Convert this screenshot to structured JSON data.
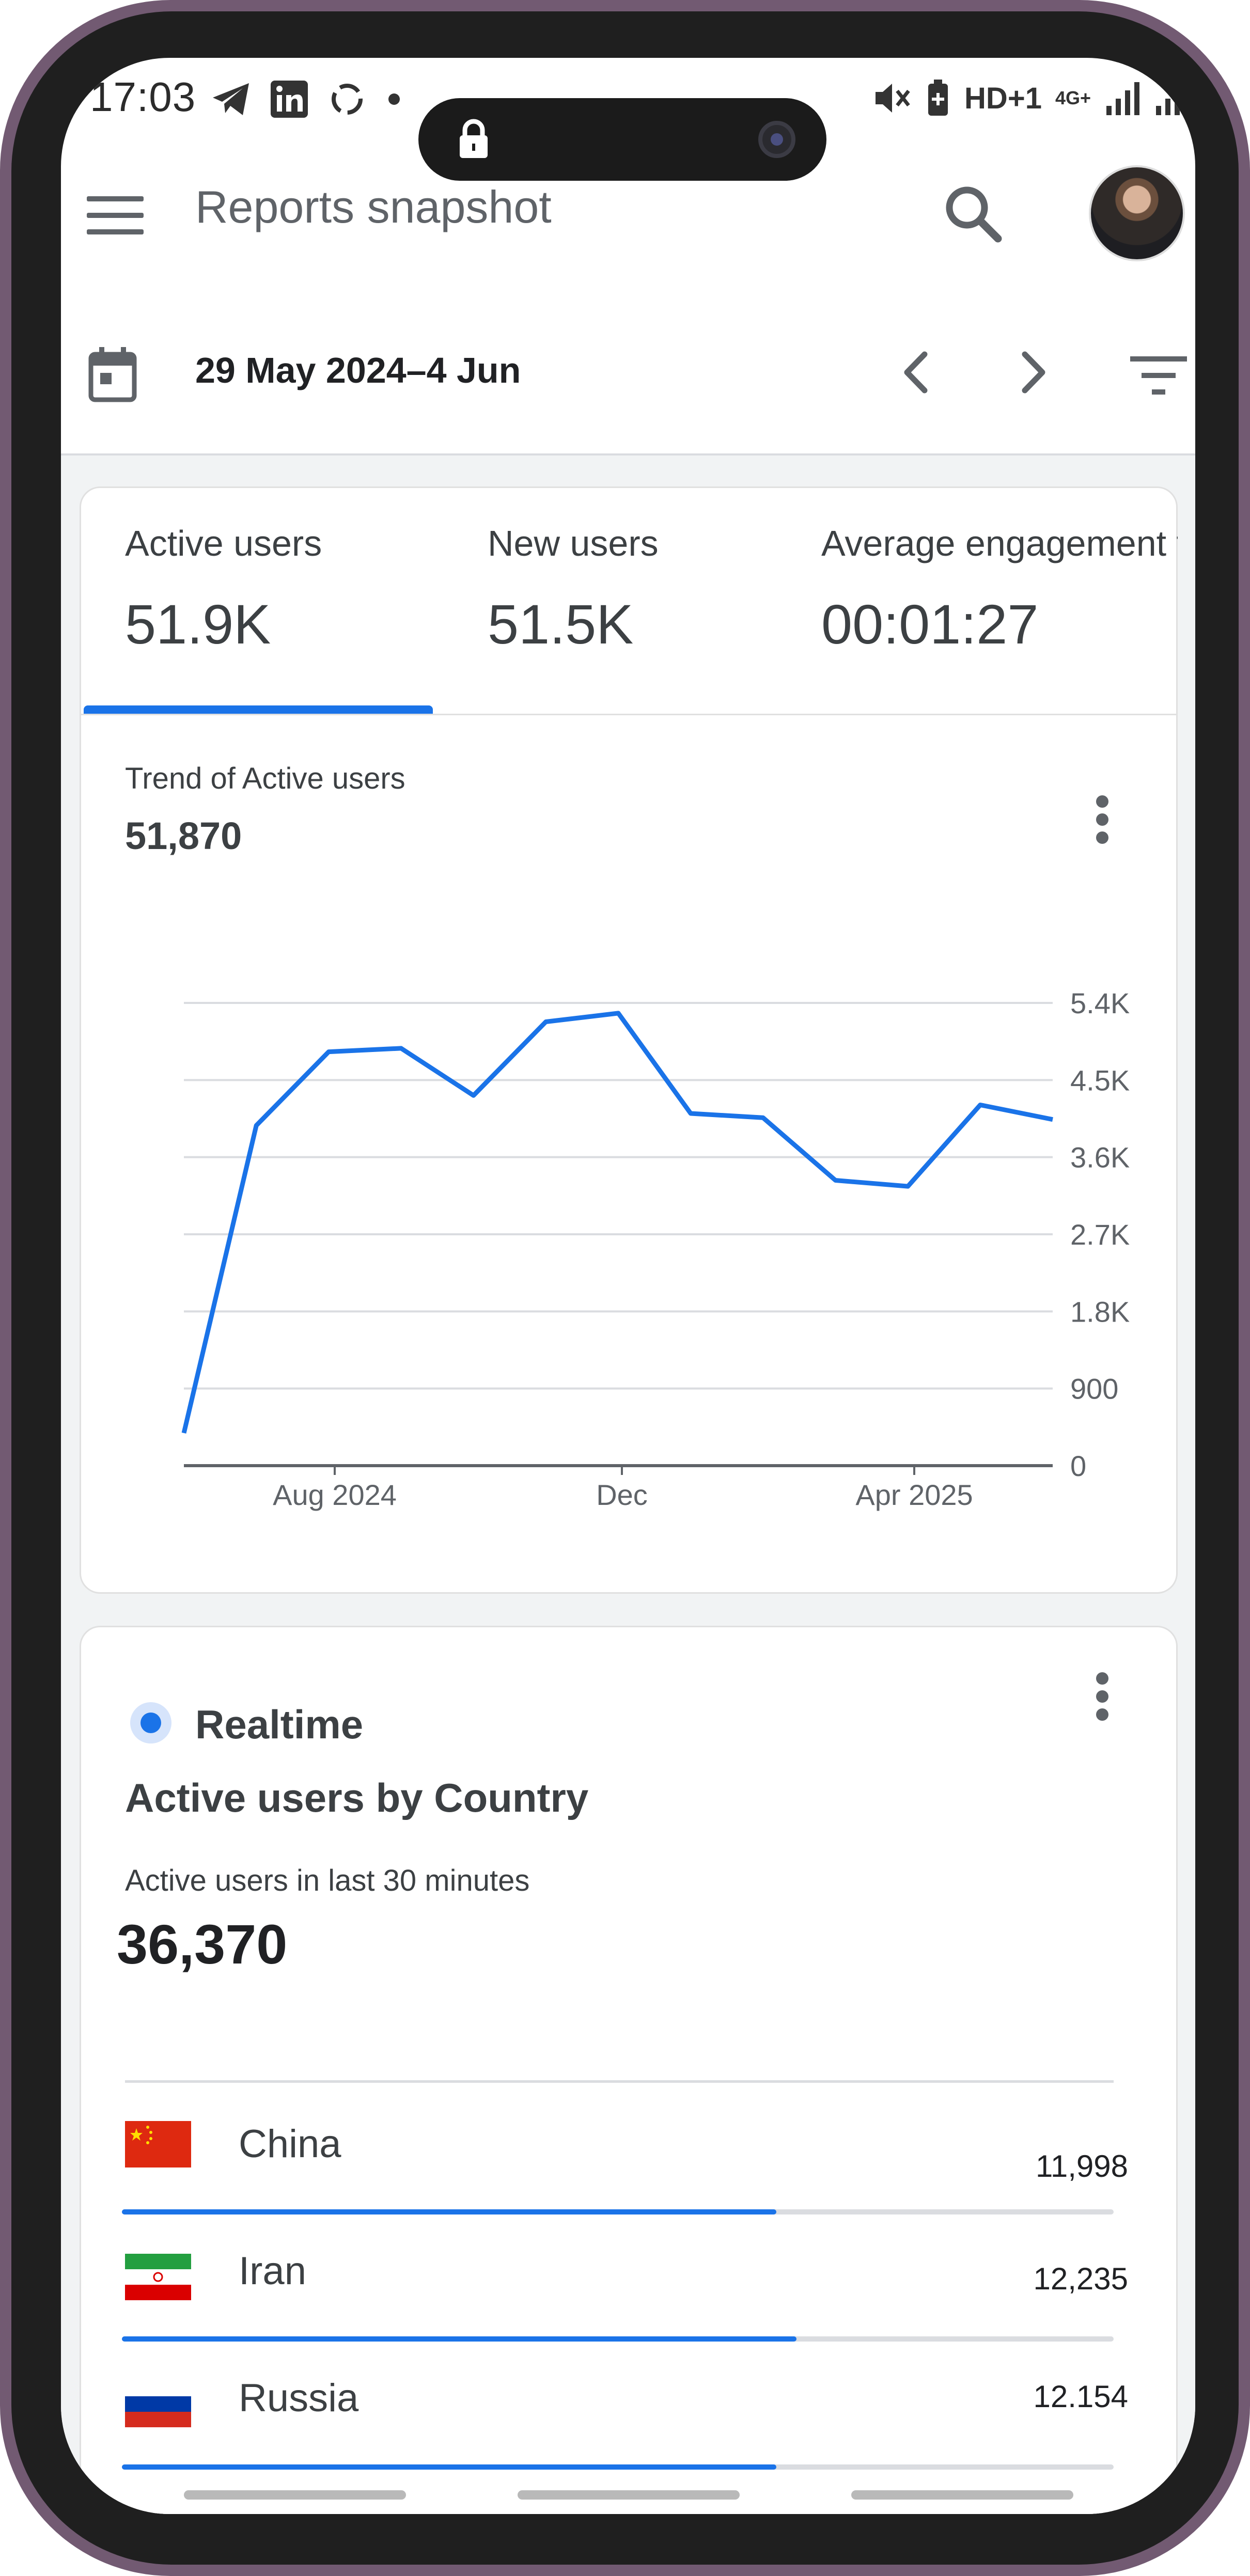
{
  "status_bar": {
    "time": "17:03",
    "right_text": "HD+1",
    "network": "4G+"
  },
  "header": {
    "title": "Reports snapshot"
  },
  "date_range": {
    "label": "29 May 2024–4 Jun"
  },
  "metrics": [
    {
      "label": "Active users",
      "value": "51.9K"
    },
    {
      "label": "New users",
      "value": "51.5K"
    },
    {
      "label": "Average engagement t",
      "value": "00:01:27"
    }
  ],
  "trend": {
    "label": "Trend of Active users",
    "value": "51,870"
  },
  "chart_data": {
    "type": "line",
    "title": "Trend of Active users",
    "xlabel": "",
    "ylabel": "",
    "x_tick_labels": [
      "Aug 2024",
      "Dec",
      "Apr 2025"
    ],
    "y_tick_labels": [
      "5.4K",
      "4.5K",
      "3.6K",
      "2.7K",
      "1.8K",
      "900",
      "0"
    ],
    "ylim": [
      0,
      5400
    ],
    "grid": true,
    "series": [
      {
        "values": [
          380,
          3970,
          4830,
          4870,
          4320,
          5180,
          5280,
          4110,
          4060,
          3330,
          3260,
          4210,
          4040
        ]
      }
    ],
    "colors": {
      "line": "#1a73e8",
      "grid": "#dadce0"
    }
  },
  "realtime": {
    "badge": "Realtime",
    "title": "Active users by Country",
    "subtitle": "Active users in last 30 minutes",
    "count": "36,370",
    "countries": [
      {
        "name": "China",
        "value": "11,998",
        "share": 0.33
      },
      {
        "name": "Iran",
        "value": "12,235",
        "share": 0.34
      },
      {
        "name": "Russia",
        "value": "12.154",
        "share": 0.33
      }
    ]
  },
  "colors": {
    "accent": "#1a73e8",
    "text": "#3c4043",
    "frame": "#725a72"
  }
}
